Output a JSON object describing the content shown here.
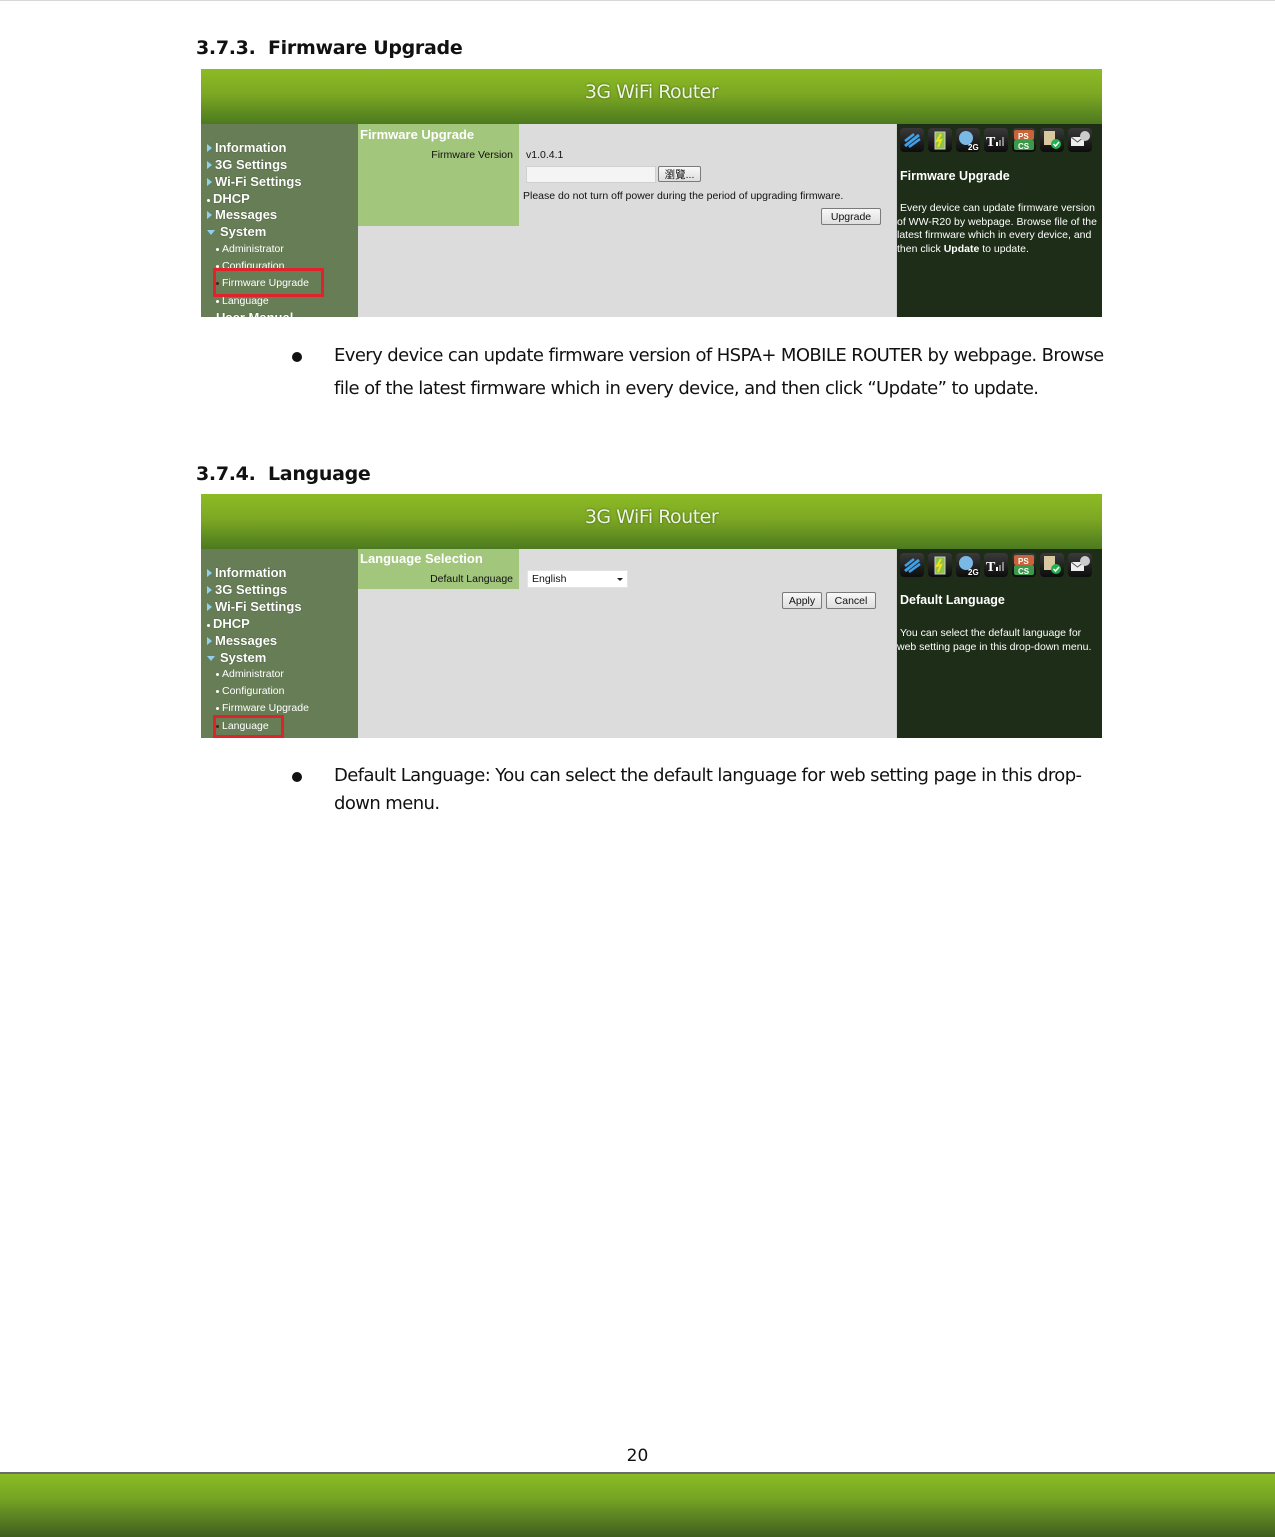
{
  "document": {
    "page_number": "20"
  },
  "sections": [
    {
      "number": "3.7.3.",
      "title": "Firmware Upgrade",
      "screenshot": {
        "app_title": "3G WiFi Router",
        "sidebar": {
          "items": [
            {
              "label": "Information",
              "icon": "triangle-right-icon"
            },
            {
              "label": "3G Settings",
              "icon": "triangle-right-icon"
            },
            {
              "label": "Wi-Fi Settings",
              "icon": "triangle-right-icon"
            },
            {
              "label": "DHCP",
              "icon": "bullet-icon"
            },
            {
              "label": "Messages",
              "icon": "triangle-right-icon"
            },
            {
              "label": "System",
              "icon": "triangle-down-icon"
            }
          ],
          "sub_items": [
            {
              "label": "Administrator"
            },
            {
              "label": "Configuration"
            },
            {
              "label": "Firmware Upgrade",
              "highlighted": true
            },
            {
              "label": "Language"
            }
          ],
          "trailing_item": "User Manual"
        },
        "panel_title": "Firmware Upgrade",
        "field_label": "Firmware Version",
        "firmware_version": "v1.0.4.1",
        "file_input_value": "",
        "browse_button": "瀏覽...",
        "warning_text": "Please do not turn off power during the period of upgrading firmware.",
        "upgrade_button": "Upgrade",
        "status_icons": [
          "wifi-signal-icon",
          "battery-icon",
          "globe-2g-icon",
          "signal-strength-icon",
          "ps-cs-icon",
          "sim-ok-icon",
          "message-icon"
        ],
        "icon_labels": {
          "network": "2G",
          "ps": "PS",
          "cs": "CS",
          "signal": "T"
        },
        "help_title": "Firmware Upgrade",
        "help_text_1": "Every device can update firmware version of WW-R20 by webpage. Browse file of the latest firmware which in every device, and then click",
        "help_bold": "Update",
        "help_text_2": "to update."
      },
      "bullet": "Every device can update firmware version of HSPA+ MOBILE ROUTER by webpage. Browse file of the latest firmware which in every device, and then click “Update” to update."
    },
    {
      "number": "3.7.4.",
      "title": "Language",
      "screenshot": {
        "app_title": "3G WiFi Router",
        "sidebar": {
          "items": [
            {
              "label": "Information",
              "icon": "triangle-right-icon"
            },
            {
              "label": "3G Settings",
              "icon": "triangle-right-icon"
            },
            {
              "label": "Wi-Fi Settings",
              "icon": "triangle-right-icon"
            },
            {
              "label": "DHCP",
              "icon": "bullet-icon"
            },
            {
              "label": "Messages",
              "icon": "triangle-right-icon"
            },
            {
              "label": "System",
              "icon": "triangle-down-icon"
            }
          ],
          "sub_items": [
            {
              "label": "Administrator"
            },
            {
              "label": "Configuration"
            },
            {
              "label": "Firmware Upgrade"
            },
            {
              "label": "Language",
              "highlighted": true
            }
          ]
        },
        "panel_title": "Language Selection",
        "field_label": "Default Language",
        "language_selected": "English",
        "apply_button": "Apply",
        "cancel_button": "Cancel",
        "status_icons": [
          "wifi-signal-icon",
          "battery-icon",
          "globe-2g-icon",
          "signal-strength-icon",
          "ps-cs-icon",
          "sim-ok-icon",
          "message-icon"
        ],
        "icon_labels": {
          "network": "2G",
          "ps": "PS",
          "cs": "CS",
          "signal": "T"
        },
        "help_title": "Default Language",
        "help_text": "You can select the default language for web setting page in this drop-down menu."
      },
      "bullet": "Default Language: You can select the default language for web setting page in this drop-down menu."
    }
  ],
  "colors": {
    "header_green": "#8dbb25",
    "sidebar_green": "#677d56",
    "panel_green": "#a2c67c",
    "help_bg": "#1e2d17",
    "highlight_red": "#e0232b"
  }
}
